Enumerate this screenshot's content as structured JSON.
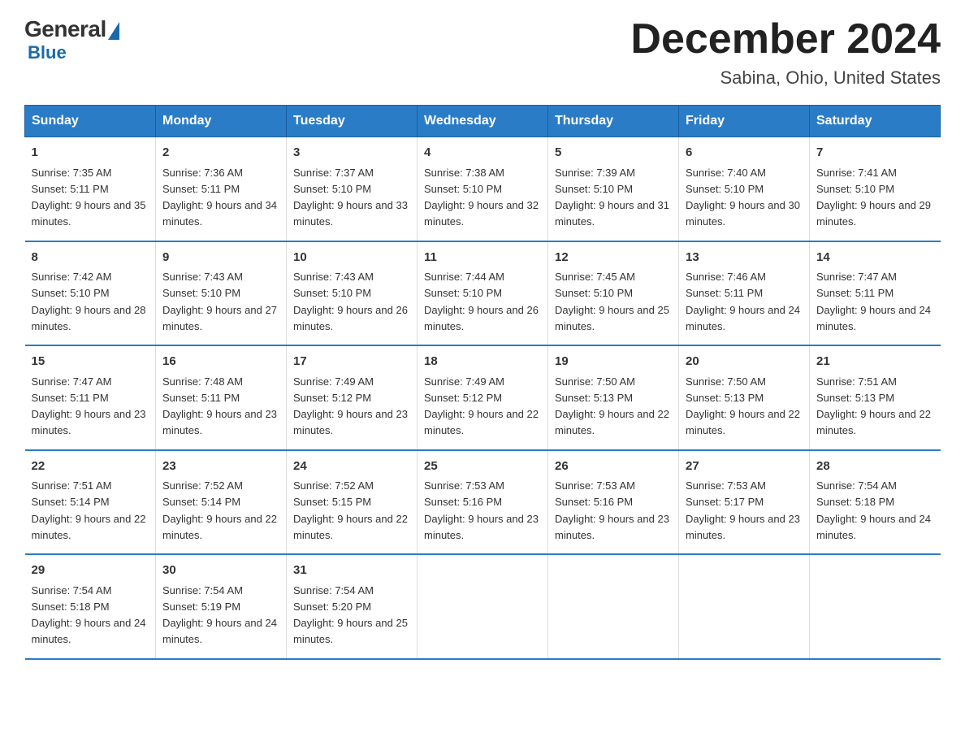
{
  "logo": {
    "general": "General",
    "blue": "Blue"
  },
  "title": "December 2024",
  "subtitle": "Sabina, Ohio, United States",
  "columns": [
    "Sunday",
    "Monday",
    "Tuesday",
    "Wednesday",
    "Thursday",
    "Friday",
    "Saturday"
  ],
  "weeks": [
    [
      {
        "day": "1",
        "sunrise": "7:35 AM",
        "sunset": "5:11 PM",
        "daylight": "9 hours and 35 minutes."
      },
      {
        "day": "2",
        "sunrise": "7:36 AM",
        "sunset": "5:11 PM",
        "daylight": "9 hours and 34 minutes."
      },
      {
        "day": "3",
        "sunrise": "7:37 AM",
        "sunset": "5:10 PM",
        "daylight": "9 hours and 33 minutes."
      },
      {
        "day": "4",
        "sunrise": "7:38 AM",
        "sunset": "5:10 PM",
        "daylight": "9 hours and 32 minutes."
      },
      {
        "day": "5",
        "sunrise": "7:39 AM",
        "sunset": "5:10 PM",
        "daylight": "9 hours and 31 minutes."
      },
      {
        "day": "6",
        "sunrise": "7:40 AM",
        "sunset": "5:10 PM",
        "daylight": "9 hours and 30 minutes."
      },
      {
        "day": "7",
        "sunrise": "7:41 AM",
        "sunset": "5:10 PM",
        "daylight": "9 hours and 29 minutes."
      }
    ],
    [
      {
        "day": "8",
        "sunrise": "7:42 AM",
        "sunset": "5:10 PM",
        "daylight": "9 hours and 28 minutes."
      },
      {
        "day": "9",
        "sunrise": "7:43 AM",
        "sunset": "5:10 PM",
        "daylight": "9 hours and 27 minutes."
      },
      {
        "day": "10",
        "sunrise": "7:43 AM",
        "sunset": "5:10 PM",
        "daylight": "9 hours and 26 minutes."
      },
      {
        "day": "11",
        "sunrise": "7:44 AM",
        "sunset": "5:10 PM",
        "daylight": "9 hours and 26 minutes."
      },
      {
        "day": "12",
        "sunrise": "7:45 AM",
        "sunset": "5:10 PM",
        "daylight": "9 hours and 25 minutes."
      },
      {
        "day": "13",
        "sunrise": "7:46 AM",
        "sunset": "5:11 PM",
        "daylight": "9 hours and 24 minutes."
      },
      {
        "day": "14",
        "sunrise": "7:47 AM",
        "sunset": "5:11 PM",
        "daylight": "9 hours and 24 minutes."
      }
    ],
    [
      {
        "day": "15",
        "sunrise": "7:47 AM",
        "sunset": "5:11 PM",
        "daylight": "9 hours and 23 minutes."
      },
      {
        "day": "16",
        "sunrise": "7:48 AM",
        "sunset": "5:11 PM",
        "daylight": "9 hours and 23 minutes."
      },
      {
        "day": "17",
        "sunrise": "7:49 AM",
        "sunset": "5:12 PM",
        "daylight": "9 hours and 23 minutes."
      },
      {
        "day": "18",
        "sunrise": "7:49 AM",
        "sunset": "5:12 PM",
        "daylight": "9 hours and 22 minutes."
      },
      {
        "day": "19",
        "sunrise": "7:50 AM",
        "sunset": "5:13 PM",
        "daylight": "9 hours and 22 minutes."
      },
      {
        "day": "20",
        "sunrise": "7:50 AM",
        "sunset": "5:13 PM",
        "daylight": "9 hours and 22 minutes."
      },
      {
        "day": "21",
        "sunrise": "7:51 AM",
        "sunset": "5:13 PM",
        "daylight": "9 hours and 22 minutes."
      }
    ],
    [
      {
        "day": "22",
        "sunrise": "7:51 AM",
        "sunset": "5:14 PM",
        "daylight": "9 hours and 22 minutes."
      },
      {
        "day": "23",
        "sunrise": "7:52 AM",
        "sunset": "5:14 PM",
        "daylight": "9 hours and 22 minutes."
      },
      {
        "day": "24",
        "sunrise": "7:52 AM",
        "sunset": "5:15 PM",
        "daylight": "9 hours and 22 minutes."
      },
      {
        "day": "25",
        "sunrise": "7:53 AM",
        "sunset": "5:16 PM",
        "daylight": "9 hours and 23 minutes."
      },
      {
        "day": "26",
        "sunrise": "7:53 AM",
        "sunset": "5:16 PM",
        "daylight": "9 hours and 23 minutes."
      },
      {
        "day": "27",
        "sunrise": "7:53 AM",
        "sunset": "5:17 PM",
        "daylight": "9 hours and 23 minutes."
      },
      {
        "day": "28",
        "sunrise": "7:54 AM",
        "sunset": "5:18 PM",
        "daylight": "9 hours and 24 minutes."
      }
    ],
    [
      {
        "day": "29",
        "sunrise": "7:54 AM",
        "sunset": "5:18 PM",
        "daylight": "9 hours and 24 minutes."
      },
      {
        "day": "30",
        "sunrise": "7:54 AM",
        "sunset": "5:19 PM",
        "daylight": "9 hours and 24 minutes."
      },
      {
        "day": "31",
        "sunrise": "7:54 AM",
        "sunset": "5:20 PM",
        "daylight": "9 hours and 25 minutes."
      },
      {
        "day": "",
        "sunrise": "",
        "sunset": "",
        "daylight": ""
      },
      {
        "day": "",
        "sunrise": "",
        "sunset": "",
        "daylight": ""
      },
      {
        "day": "",
        "sunrise": "",
        "sunset": "",
        "daylight": ""
      },
      {
        "day": "",
        "sunrise": "",
        "sunset": "",
        "daylight": ""
      }
    ]
  ],
  "labels": {
    "sunrise": "Sunrise: ",
    "sunset": "Sunset: ",
    "daylight": "Daylight: "
  }
}
